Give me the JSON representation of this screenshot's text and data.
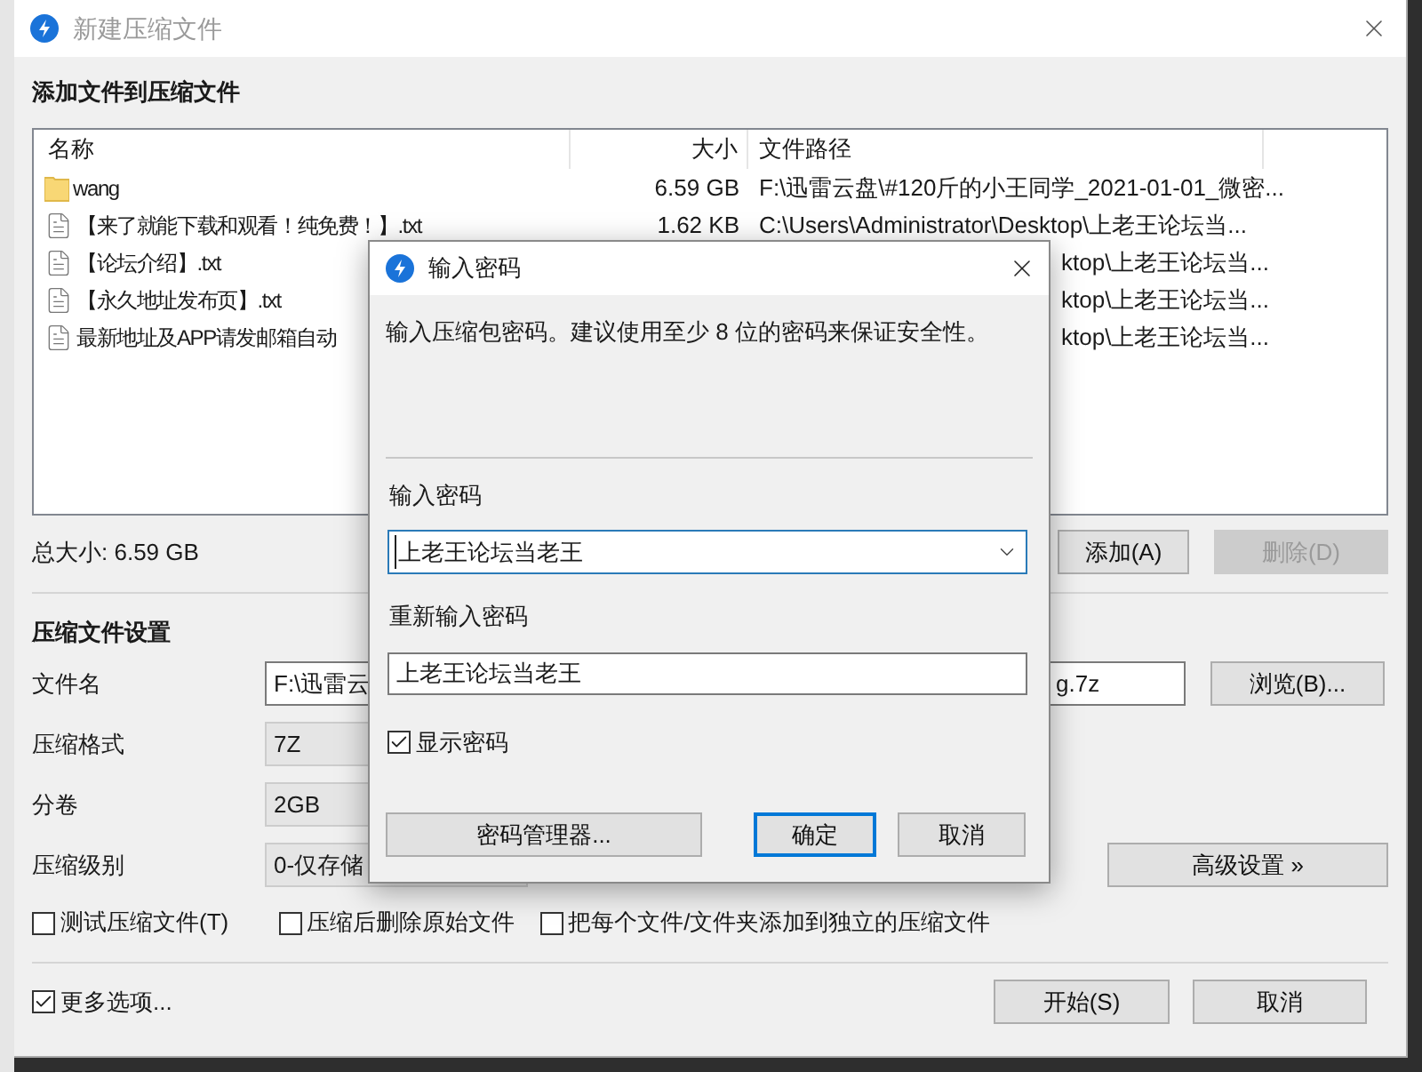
{
  "main_window": {
    "title": "新建压缩文件",
    "files_heading": "添加文件到压缩文件",
    "file_list": {
      "columns": [
        "名称",
        "大小",
        "文件路径"
      ],
      "rows": [
        {
          "kind": "folder",
          "name": "wang",
          "size": "6.59 GB",
          "path": "F:\\迅雷云盘\\#120斤的小王同学_2021-01-01_微密..."
        },
        {
          "kind": "file",
          "name": "【来了就能下载和观看！纯免费！】.txt",
          "size": "1.62 KB",
          "path": "C:\\Users\\Administrator\\Desktop\\上老王论坛当..."
        },
        {
          "kind": "file",
          "name": "【论坛介绍】.txt",
          "path": "ktop\\上老王论坛当..."
        },
        {
          "kind": "file",
          "name": "【永久地址发布页】.txt",
          "path": "ktop\\上老王论坛当..."
        },
        {
          "kind": "file",
          "name": "最新地址及APP请发邮箱自动",
          "path": "ktop\\上老王论坛当..."
        }
      ]
    },
    "total_size": "总大小: 6.59 GB",
    "add_button": {
      "label": "添加(A)",
      "disabled": false
    },
    "delete_button": {
      "label": "删除(D)",
      "disabled": true
    },
    "settings_heading": "压缩文件设置",
    "settings": [
      {
        "label": "文件名",
        "kind": "text",
        "value": "F:\\迅雷云",
        "value_tail": "g.7z"
      },
      {
        "label": "压缩格式",
        "kind": "combo",
        "value": "7Z"
      },
      {
        "label": "分卷",
        "kind": "combo",
        "value": "2GB"
      },
      {
        "label": "压缩级别",
        "kind": "combo",
        "value": "0-仅存储"
      }
    ],
    "browse_button": "浏览(B)...",
    "advanced_button": "高级设置 »",
    "options": [
      {
        "label": "测试压缩文件(T)",
        "checked": false
      },
      {
        "label": "压缩后删除原始文件",
        "checked": false
      },
      {
        "label": "把每个文件/文件夹添加到独立的压缩文件",
        "checked": false
      }
    ],
    "more_options": {
      "label": "更多选项...",
      "checked": true
    },
    "start_button": "开始(S)",
    "cancel_button": "取消"
  },
  "password_dialog": {
    "title": "输入密码",
    "message": "输入压缩包密码。建议使用至少 8 位的密码来保证安全性。",
    "password_label": "输入密码",
    "password": "上老王论坛当老王",
    "repeat_label": "重新输入密码",
    "repeat_password": "上老王论坛当老王",
    "show_password": {
      "label": "显示密码",
      "checked": true
    },
    "manager_button": "密码管理器...",
    "ok_button": "确定",
    "cancel_button": "取消"
  }
}
